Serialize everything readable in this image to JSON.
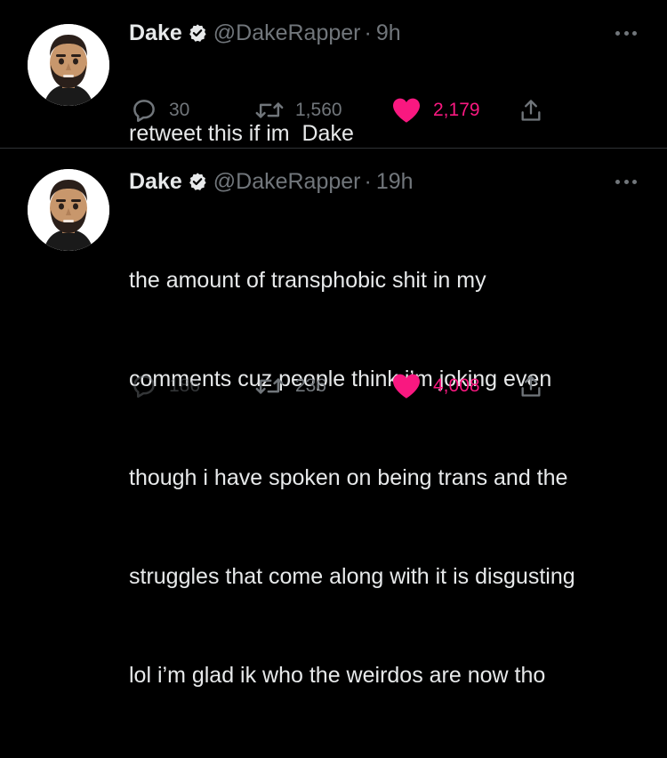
{
  "accent_color": "#f91880",
  "verified_color": "#e7e9ea",
  "tweets": [
    {
      "display_name": "Dake",
      "handle": "@DakeRapper",
      "separator": "·",
      "time": "9h",
      "body_lines": [
        "retweet this if im  Dake"
      ],
      "replies": "30",
      "retweets": "1,560",
      "likes": "2,179",
      "liked": true
    },
    {
      "display_name": "Dake",
      "handle": "@DakeRapper",
      "separator": "·",
      "time": "19h",
      "body_lines": [
        "the amount of transphobic shit in my",
        "comments cuz people think i’m joking even",
        "though i have spoken on being trans and the",
        "struggles that come along with it is disgusting",
        "lol i’m glad ik who the weirdos are now tho"
      ],
      "replies": "186",
      "retweets": "236",
      "likes": "4,008",
      "liked": true
    }
  ],
  "icons": {
    "avatar": "memoji-avatar",
    "verified": "verified-badge-icon",
    "more": "more-dots-icon",
    "reply": "reply-icon",
    "retweet": "retweet-icon",
    "like": "heart-icon",
    "share": "share-icon"
  }
}
